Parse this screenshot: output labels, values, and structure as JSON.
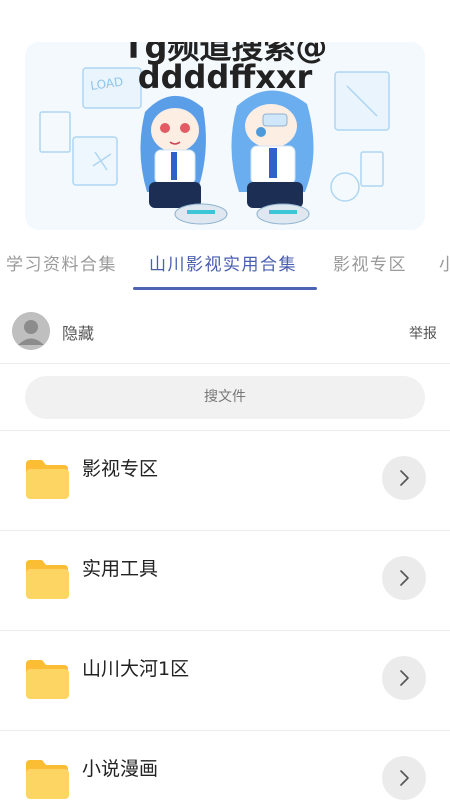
{
  "banner": {
    "text_line1": "Tg频道搜索@",
    "text_line2": "ddddffxxr",
    "sign_text": "LOAD"
  },
  "tabs": [
    {
      "label": "学习资料合集",
      "active": false
    },
    {
      "label": "山川影视实用合集",
      "active": true
    },
    {
      "label": "影视专区",
      "active": false
    },
    {
      "label": "小",
      "active": false
    }
  ],
  "owner": {
    "name": "隐藏",
    "report_label": "举报"
  },
  "search": {
    "placeholder": "搜文件"
  },
  "folders": [
    {
      "label": "影视专区",
      "icon": "folder-icon"
    },
    {
      "label": "实用工具",
      "icon": "folder-icon"
    },
    {
      "label": "山川大河1区",
      "icon": "folder-icon"
    },
    {
      "label": "小说漫画",
      "icon": "folder-icon"
    }
  ],
  "colors": {
    "accent": "#4d63b4",
    "folder": "#fdd563",
    "folder_tab": "#fbbd33"
  }
}
